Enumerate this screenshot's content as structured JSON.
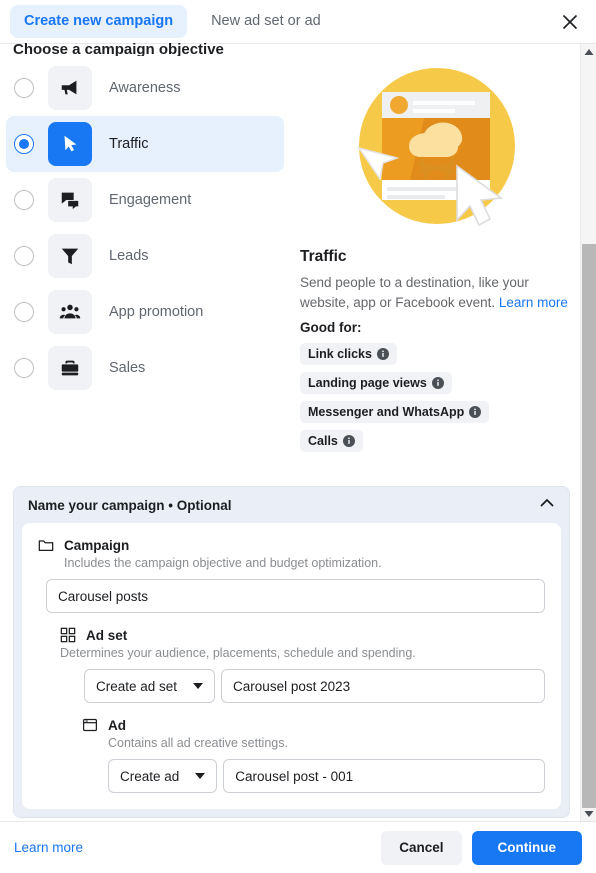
{
  "header": {
    "tab_create_campaign": "Create new campaign",
    "tab_new_adset_or_ad": "New ad set or ad",
    "close_label": "close-icon"
  },
  "section": {
    "title": "Choose a campaign objective"
  },
  "objectives": [
    {
      "label": "Awareness",
      "icon": "megaphone-icon",
      "selected": false
    },
    {
      "label": "Traffic",
      "icon": "cursor-arrow-icon",
      "selected": true
    },
    {
      "label": "Engagement",
      "icon": "chat-bubbles-icon",
      "selected": false
    },
    {
      "label": "Leads",
      "icon": "funnel-icon",
      "selected": false
    },
    {
      "label": "App promotion",
      "icon": "people-group-icon",
      "selected": false
    },
    {
      "label": "Sales",
      "icon": "briefcase-icon",
      "selected": false
    }
  ],
  "detail": {
    "title": "Traffic",
    "description": "Send people to a destination, like your website, app or Facebook event.",
    "learn_more": "Learn more",
    "good_for_label": "Good for:",
    "chips": [
      {
        "label": "Link clicks"
      },
      {
        "label": "Landing page views"
      },
      {
        "label": "Messenger and WhatsApp"
      },
      {
        "label": "Calls"
      }
    ]
  },
  "name_campaign": {
    "header_title": "Name your campaign • Optional",
    "collapse_icon": "chevron-up-icon",
    "campaign": {
      "icon": "folder-icon",
      "title": "Campaign",
      "subtitle": "Includes the campaign objective and budget optimization.",
      "value": "Carousel posts"
    },
    "ad_set": {
      "icon": "grid-icon",
      "title": "Ad set",
      "subtitle": "Determines your audience, placements, schedule and spending.",
      "select_value": "Create ad set",
      "value": "Carousel post 2023"
    },
    "ad": {
      "icon": "window-icon",
      "title": "Ad",
      "subtitle": "Contains all ad creative settings.",
      "select_value": "Create ad",
      "value": "Carousel post - 001"
    }
  },
  "footer": {
    "learn_more": "Learn more",
    "cancel": "Cancel",
    "continue": "Continue"
  },
  "colors": {
    "accent": "#1877f2",
    "selected_row": "#e7f0fd",
    "chip_bg": "#f0f2f5",
    "panel_bg": "#eaeff7",
    "illustration_primary": "#f7b928",
    "illustration_secondary": "#e08b1a"
  }
}
